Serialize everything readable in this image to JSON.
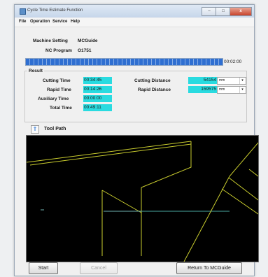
{
  "window": {
    "title": "Cycle Time Estimate Function"
  },
  "titlebar_buttons": {
    "minimize": "–",
    "maximize": "□",
    "close": "x"
  },
  "menu": [
    "File",
    "Operation",
    "Service",
    "Help"
  ],
  "machine_setting": {
    "label": "Machine Setting",
    "value": "MCGuide"
  },
  "nc_program": {
    "label": "NC Program",
    "value": "O1751"
  },
  "progress": {
    "fraction": 1.0,
    "time": "00:02:00"
  },
  "result": {
    "title": "Result",
    "cutting_time": {
      "label": "Cutting Time",
      "value": "00:34:45"
    },
    "rapid_time": {
      "label": "Rapid Time",
      "value": "00:14:26"
    },
    "auxiliary_time": {
      "label": "Auxiliary Time",
      "value": "00:00:00"
    },
    "total_time": {
      "label": "Total Time",
      "value": "00:49:11"
    },
    "cutting_distance": {
      "label": "Cutting Distance",
      "value": "54154",
      "unit": "mm"
    },
    "rapid_distance": {
      "label": "Rapid Distance",
      "value": "159575",
      "unit": "mm"
    }
  },
  "tool_path": {
    "label": "Tool Path",
    "toggle_glyph": "⇑"
  },
  "buttons": {
    "start": "Start",
    "cancel": "Cancel",
    "return": "Return To MCGuide"
  },
  "colors": {
    "path_line": "#c9cc2e",
    "cyan_field": "#29dbe0",
    "progress": "#2f6fd1"
  }
}
